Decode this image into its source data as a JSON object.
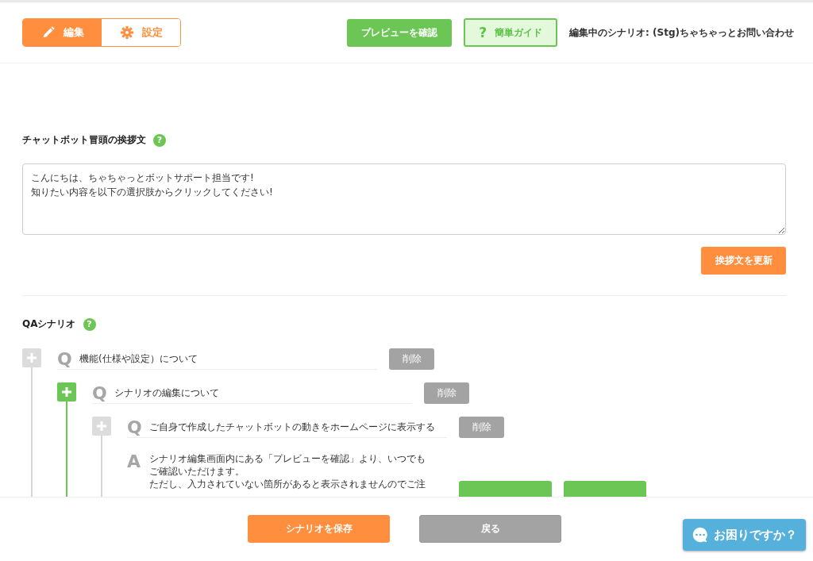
{
  "header": {
    "tabs": [
      {
        "label": "編集",
        "kind": "pencil",
        "selected": true
      },
      {
        "label": "設定",
        "kind": "gear",
        "selected": false
      }
    ],
    "preview_button": "プレビューを確認",
    "guide_button": {
      "mark": "?",
      "label": "簡単ガイド"
    },
    "scenario_label": "編集中のシナリオ: (Stg)ちゃちゃっとお問い合わせ"
  },
  "greeting": {
    "title": "チャットボット冒頭の挨拶文",
    "help": "?",
    "value": "こんにちは、ちゃちゃっとボットサポート担当です!\n知りたい内容を以下の選択肢からクリックしてください!",
    "update_button": "挨拶文を更新"
  },
  "scenario": {
    "title": "QAシナリオ",
    "help": "?",
    "nodes": [
      {
        "kind": "question",
        "marker": "Q",
        "text": "機能(仕様や設定）について",
        "selected": false,
        "delete_button": "削除",
        "children": [
          {
            "kind": "question",
            "marker": "Q",
            "text": "シナリオの編集について",
            "selected": true,
            "delete_button": "削除",
            "children": [
              {
                "kind": "question",
                "marker": "Q",
                "text": "ご自身で作成したチャットボットの動きをホームページに表示する",
                "selected": false,
                "delete_button": "削除",
                "children": [
                  {
                    "kind": "answer",
                    "marker": "A",
                    "lines": [
                      "シナリオ編集画面内にある「プレビューを確認」より、いつでも",
                      "ご確認いただけます。",
                      "ただし、入力されていない箇所があると表示されませんのでご注"
                    ]
                  }
                ]
              }
            ]
          }
        ]
      }
    ]
  },
  "footer": {
    "save_button": "シナリオを保存",
    "back_button": "戻る",
    "help_button": "お困りですか？"
  }
}
